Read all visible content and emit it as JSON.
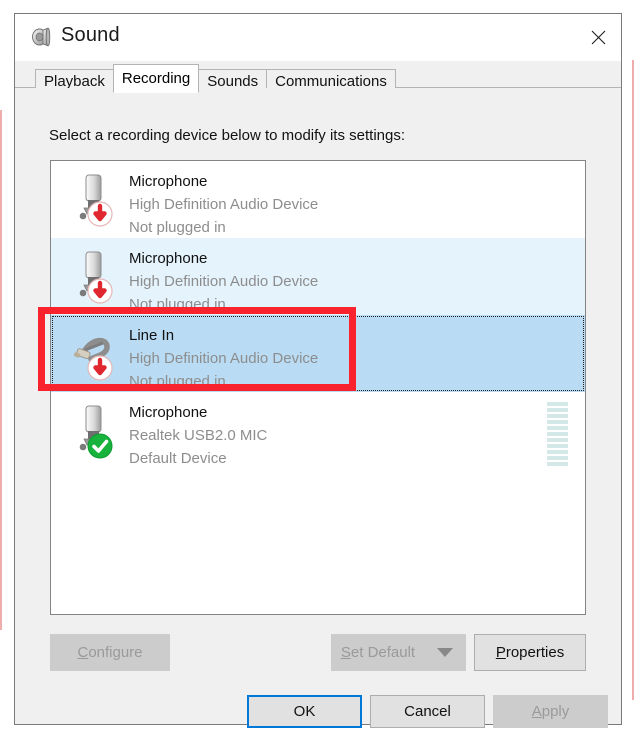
{
  "window": {
    "title": "Sound",
    "icon": "speaker-icon",
    "close_label": "✕"
  },
  "tabs": [
    {
      "label": "Playback",
      "active": false
    },
    {
      "label": "Recording",
      "active": true
    },
    {
      "label": "Sounds",
      "active": false
    },
    {
      "label": "Communications",
      "active": false
    }
  ],
  "main": {
    "prompt": "Select a recording device below to modify its settings:"
  },
  "devices": [
    {
      "name": "Microphone",
      "description": "High Definition Audio Device",
      "status": "Not plugged in",
      "icon": "microphone-icon",
      "badge": "red-down-arrow-badge",
      "state": "normal",
      "meter": false
    },
    {
      "name": "Microphone",
      "description": "High Definition Audio Device",
      "status": "Not plugged in",
      "icon": "microphone-icon",
      "badge": "red-down-arrow-badge",
      "state": "hover",
      "meter": false
    },
    {
      "name": "Line In",
      "description": "High Definition Audio Device",
      "status": "Not plugged in",
      "icon": "line-in-jack-icon",
      "badge": "red-down-arrow-badge",
      "state": "selected",
      "meter": false
    },
    {
      "name": "Microphone",
      "description": "Realtek USB2.0 MIC",
      "status": "Default Device",
      "icon": "microphone-icon",
      "badge": "green-check-badge",
      "state": "normal",
      "meter": true,
      "meter_segments": 11,
      "meter_active": 0
    }
  ],
  "device_buttons": {
    "configure": {
      "label": "Configure",
      "accel": "C",
      "enabled": false
    },
    "set_default": {
      "label": "Set Default",
      "accel": "S",
      "enabled": false
    },
    "set_default_arrow": {
      "icon": "chevron-down-icon",
      "enabled": false
    },
    "properties": {
      "label": "Properties",
      "accel": "P",
      "enabled": true
    }
  },
  "footer_buttons": {
    "ok": {
      "label": "OK",
      "enabled": true,
      "default": true
    },
    "cancel": {
      "label": "Cancel",
      "enabled": true,
      "default": false
    },
    "apply": {
      "label": "Apply",
      "accel": "A",
      "enabled": false,
      "default": false
    }
  },
  "annotation": {
    "type": "red-rectangle-highlight",
    "target": "Line In",
    "color": "#f8232d"
  }
}
